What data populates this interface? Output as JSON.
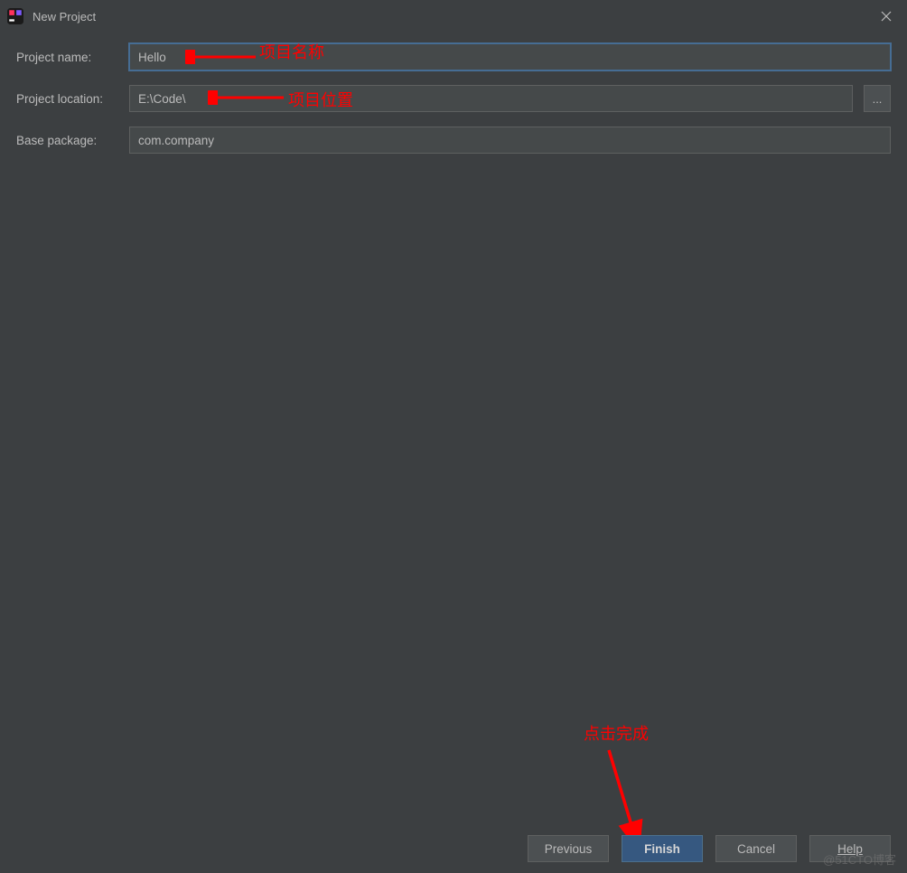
{
  "window": {
    "title": "New Project"
  },
  "form": {
    "project_name_label": "Project name:",
    "project_name_value": "Hello",
    "project_location_label": "Project location:",
    "project_location_value": "E:\\Code\\",
    "base_package_label": "Base package:",
    "base_package_value": "com.company",
    "browse_label": "..."
  },
  "annotations": {
    "name_hint": "项目名称",
    "location_hint": "项目位置",
    "finish_hint": "点击完成"
  },
  "buttons": {
    "previous": "Previous",
    "finish": "Finish",
    "cancel": "Cancel",
    "help": "Help"
  },
  "watermark": "@51CTO博客"
}
